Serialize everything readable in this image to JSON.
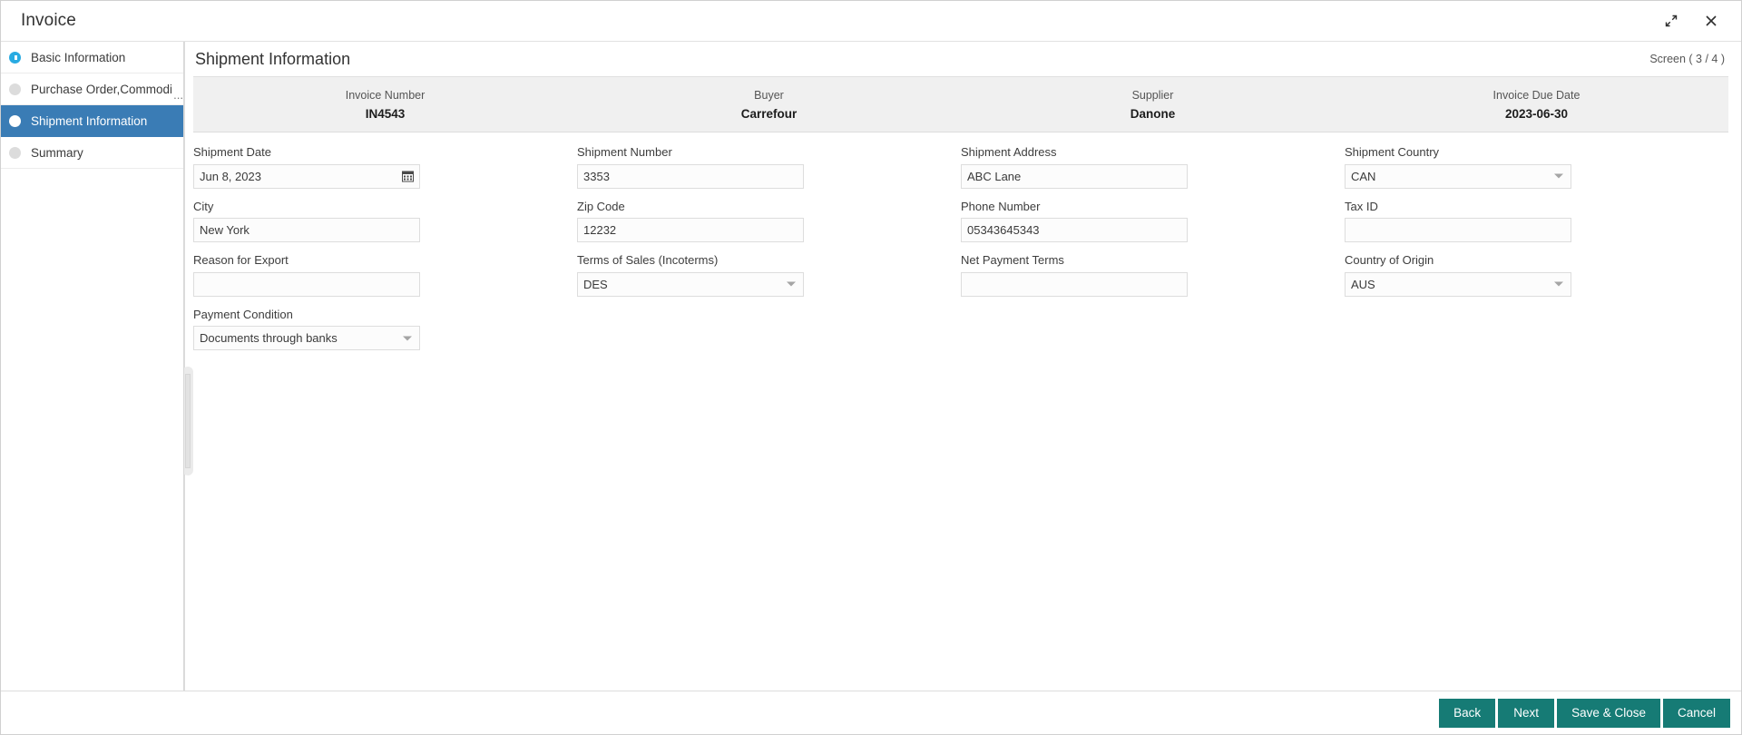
{
  "titlebar": {
    "title": "Invoice",
    "restore_icon": "restore-window-icon",
    "close_icon": "close-icon"
  },
  "sidebar": {
    "items": [
      {
        "label": "Basic Information",
        "state": "completed",
        "ellipsis": ""
      },
      {
        "label": "Purchase Order,Commodity",
        "state": "pending",
        "ellipsis": "..."
      },
      {
        "label": "Shipment Information",
        "state": "active",
        "ellipsis": ""
      },
      {
        "label": "Summary",
        "state": "pending",
        "ellipsis": ""
      }
    ]
  },
  "main": {
    "page_title": "Shipment Information",
    "screen_counter": "Screen ( 3 / 4 )"
  },
  "summary": {
    "cells": [
      {
        "label": "Invoice Number",
        "value": "IN4543"
      },
      {
        "label": "Buyer",
        "value": "Carrefour"
      },
      {
        "label": "Supplier",
        "value": "Danone"
      },
      {
        "label": "Invoice Due Date",
        "value": "2023-06-30"
      }
    ]
  },
  "form": {
    "fields": [
      {
        "label": "Shipment Date",
        "value": "Jun 8, 2023",
        "type": "date",
        "name": "shipment-date"
      },
      {
        "label": "Shipment Number",
        "value": "3353",
        "type": "text",
        "name": "shipment-number"
      },
      {
        "label": "Shipment Address",
        "value": "ABC Lane",
        "type": "text",
        "name": "shipment-address"
      },
      {
        "label": "Shipment Country",
        "value": "CAN",
        "type": "select",
        "name": "shipment-country"
      },
      {
        "label": "City",
        "value": "New York",
        "type": "text",
        "name": "city"
      },
      {
        "label": "Zip Code",
        "value": "12232",
        "type": "text",
        "name": "zip-code"
      },
      {
        "label": "Phone Number",
        "value": "05343645343",
        "type": "text",
        "name": "phone-number"
      },
      {
        "label": "Tax ID",
        "value": "",
        "type": "text",
        "name": "tax-id"
      },
      {
        "label": "Reason for Export",
        "value": "",
        "type": "text",
        "name": "reason-for-export"
      },
      {
        "label": "Terms of Sales (Incoterms)",
        "value": "DES",
        "type": "select",
        "name": "terms-of-sales"
      },
      {
        "label": "Net Payment Terms",
        "value": "",
        "type": "text",
        "name": "net-payment-terms"
      },
      {
        "label": "Country of Origin",
        "value": "AUS",
        "type": "select",
        "name": "country-of-origin"
      },
      {
        "label": "Payment Condition",
        "value": "Documents through banks",
        "type": "select",
        "name": "payment-condition"
      }
    ]
  },
  "footer": {
    "buttons": [
      {
        "label": "Back",
        "name": "back-button"
      },
      {
        "label": "Next",
        "name": "next-button"
      },
      {
        "label": "Save & Close",
        "name": "save-and-close-button"
      },
      {
        "label": "Cancel",
        "name": "cancel-button"
      }
    ]
  },
  "colors": {
    "accent_teal": "#167b75",
    "nav_active_blue": "#3a7cb5",
    "step_cyan": "#29abe2"
  }
}
